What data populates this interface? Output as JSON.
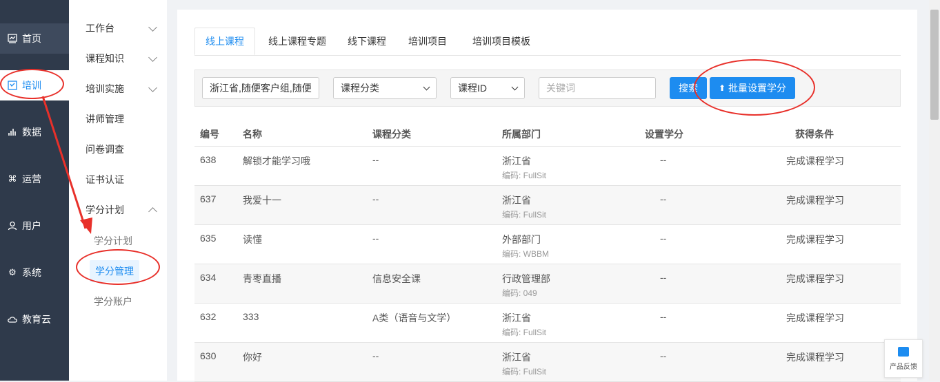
{
  "nav": {
    "items": [
      {
        "label": "首页",
        "icon": "chart-icon"
      },
      {
        "label": "培训",
        "icon": "training-icon"
      },
      {
        "label": "数据",
        "icon": "bar-chart-icon"
      },
      {
        "label": "运营",
        "icon": "command-icon"
      },
      {
        "label": "用户",
        "icon": "user-icon"
      },
      {
        "label": "系统",
        "icon": "gear-icon"
      },
      {
        "label": "教育云",
        "icon": "cloud-icon"
      }
    ]
  },
  "submenu": {
    "groups": [
      {
        "label": "工作台",
        "chevron": "down"
      },
      {
        "label": "课程知识",
        "chevron": "down"
      },
      {
        "label": "培训实施",
        "chevron": "down"
      },
      {
        "label": "讲师管理"
      },
      {
        "label": "问卷调查"
      },
      {
        "label": "证书认证"
      },
      {
        "label": "学分计划",
        "chevron": "up"
      }
    ],
    "children": [
      "学分计划",
      "学分管理",
      "学分账户"
    ]
  },
  "tabs": [
    "线上课程",
    "线上课程专题",
    "线下课程",
    "培训项目",
    "培训项目模板"
  ],
  "filter": {
    "department_value": "浙江省,随便客户组,随便",
    "category_value": "课程分类",
    "id_type_value": "课程ID",
    "keyword_placeholder": "关键词",
    "search_label": "搜索",
    "batch_label": "批量设置学分"
  },
  "table": {
    "headers": [
      "编号",
      "名称",
      "课程分类",
      "所属部门",
      "设置学分",
      "获得条件"
    ],
    "code_prefix": "编码: ",
    "rows": [
      {
        "id": "638",
        "name": "解锁才能学习哦",
        "category": "--",
        "dept": "浙江省",
        "code": "编码: FullSit",
        "credit": "--",
        "condition": "完成课程学习"
      },
      {
        "id": "637",
        "name": "我爱十一",
        "category": "--",
        "dept": "浙江省",
        "code": "编码: FullSit",
        "credit": "--",
        "condition": "完成课程学习"
      },
      {
        "id": "635",
        "name": "读懂",
        "category": "--",
        "dept": "外部部门",
        "code": "编码: WBBM",
        "credit": "--",
        "condition": "完成课程学习"
      },
      {
        "id": "634",
        "name": "青枣直播",
        "category": "信息安全课",
        "dept": "行政管理部",
        "code": "编码: 049",
        "credit": "--",
        "condition": "完成课程学习"
      },
      {
        "id": "632",
        "name": "333",
        "category": "A类（语音与文学）",
        "dept": "浙江省",
        "code": "编码: FullSit",
        "credit": "--",
        "condition": "完成课程学习"
      },
      {
        "id": "630",
        "name": "你好",
        "category": "--",
        "dept": "浙江省",
        "code": "编码: FullSit",
        "credit": "--",
        "condition": "完成课程学习"
      }
    ]
  },
  "feedback": {
    "label": "产品反馈"
  },
  "colors": {
    "accent": "#1d8cf0",
    "nav_bg": "#2f3a4b",
    "annotation": "#e8302a"
  }
}
